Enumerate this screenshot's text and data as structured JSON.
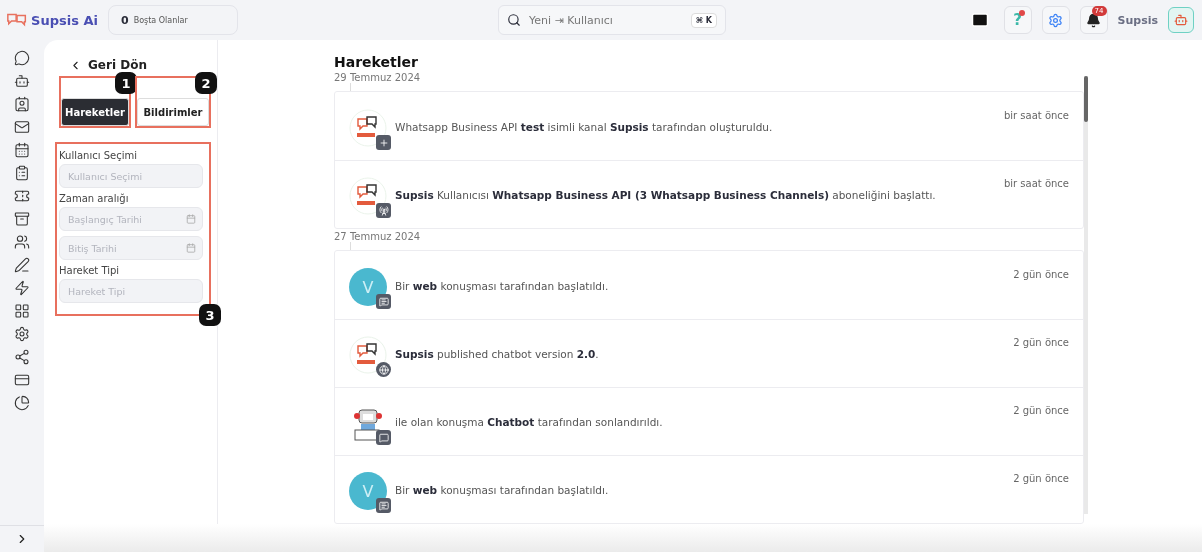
{
  "app": {
    "name": "Supsis Ai"
  },
  "idle": {
    "count": "0",
    "label": "Boşta Olanlar"
  },
  "search": {
    "placeholder": "Yeni ⇥ Kullanıcı",
    "shortcut": "⌘ K"
  },
  "topbar": {
    "help_label": "?",
    "help_dot": true,
    "notifications": "74",
    "user": "Supsis"
  },
  "back": {
    "label": "Geri Dön"
  },
  "tabs": [
    {
      "label": "Hareketler",
      "selected": true,
      "marker": "1"
    },
    {
      "label": "Bildirimler",
      "selected": false,
      "marker": "2"
    }
  ],
  "filters": {
    "marker": "3",
    "groups": [
      {
        "label": "Kullanıcı Seçimi",
        "fields": [
          {
            "placeholder": "Kullanıcı Seçimi",
            "kind": "select"
          }
        ]
      },
      {
        "label": "Zaman aralığı",
        "fields": [
          {
            "placeholder": "Başlangıç Tarihi",
            "kind": "date"
          },
          {
            "placeholder": "Bitiş Tarihi",
            "kind": "date"
          }
        ]
      },
      {
        "label": "Hareket Tipi",
        "fields": [
          {
            "placeholder": "Hareket Tipi",
            "kind": "select"
          }
        ]
      }
    ]
  },
  "timeline": {
    "title": "Hareketler",
    "groups": [
      {
        "date": "29 Temmuz 2024",
        "events": [
          {
            "avatar": {
              "kind": "logo"
            },
            "badge": {
              "kind": "plus"
            },
            "text": "Whatsapp Business API **test** isimli kanal **Supsis** tarafından oluşturuldu.",
            "time": "bir saat önce"
          },
          {
            "avatar": {
              "kind": "logo"
            },
            "badge": {
              "kind": "antenna"
            },
            "text": "**Supsis** Kullanıcısı **Whatsapp Business API (3 Whatsapp Business Channels)** aboneliğini başlattı.",
            "time": "bir saat önce"
          }
        ]
      },
      {
        "date": "27 Temmuz 2024",
        "events": [
          {
            "avatar": {
              "kind": "letter",
              "letter": "V"
            },
            "badge": {
              "kind": "chat"
            },
            "text": "Bir **web** konuşması tarafından başlatıldı.",
            "time": "2 gün önce"
          },
          {
            "avatar": {
              "kind": "logo"
            },
            "badge": {
              "kind": "globe"
            },
            "text": "**Supsis** published chatbot version **2.0**.",
            "time": "2 gün önce"
          },
          {
            "avatar": {
              "kind": "robot"
            },
            "badge": {
              "kind": "chat-check"
            },
            "text": "ile olan konuşma **Chatbot** tarafından sonlandırıldı.",
            "time": "2 gün önce"
          },
          {
            "avatar": {
              "kind": "letter",
              "letter": "V"
            },
            "badge": {
              "kind": "chat"
            },
            "text": "Bir **web** konuşması tarafından başlatıldı.",
            "time": "2 gün önce"
          }
        ]
      }
    ]
  }
}
